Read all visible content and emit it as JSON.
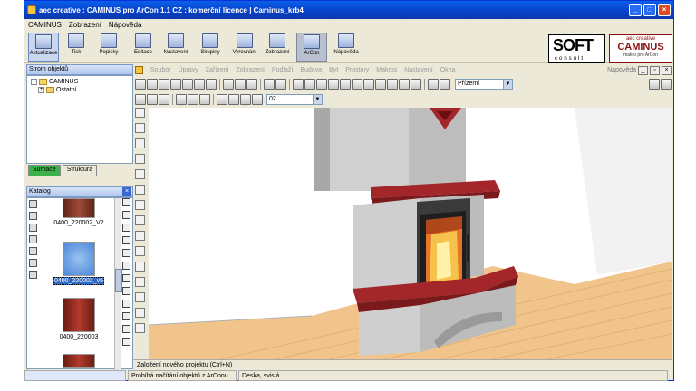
{
  "window": {
    "title": "aec creative : CAMINUS pro ArCon 1.1 CZ : komerční licence | Caminus_krb4",
    "controls": [
      "_",
      "□",
      "×"
    ]
  },
  "menu": [
    "CAMINUS",
    "Zobrazení",
    "Nápověda"
  ],
  "big_toolbar": [
    {
      "label": "Aktualizace",
      "icon": "update-icon"
    },
    {
      "label": "Tisk",
      "icon": "printer-icon"
    },
    {
      "label": "Popisky",
      "icon": "labels-icon"
    },
    {
      "label": "Editace",
      "icon": "edit-icon"
    },
    {
      "label": "Nastavení",
      "icon": "settings-icon"
    },
    {
      "label": "Skupiny",
      "icon": "groups-icon"
    },
    {
      "label": "Vyrovnání",
      "icon": "align-icon"
    },
    {
      "label": "Zobrazení",
      "icon": "view-icon"
    },
    {
      "label": "ArCon",
      "icon": "arcon-icon"
    },
    {
      "label": "Nápověda",
      "icon": "help-icon"
    }
  ],
  "logos": {
    "soft_big": "SOFT",
    "soft_small": "consult",
    "caminus_top": "aec creative",
    "caminus_main": "CAMINUS",
    "caminus_sub": "makro pro ArCon"
  },
  "object_tree": {
    "title": "Strom objektů",
    "items": [
      {
        "label": "CAMINUS",
        "expand": "-"
      },
      {
        "label": "Ostatní",
        "expand": "+"
      }
    ]
  },
  "tabs": [
    {
      "label": "Sumace",
      "active": true
    },
    {
      "label": "Struktura",
      "active": false
    }
  ],
  "catalog": {
    "title": "Katalog",
    "items": [
      {
        "label": "0400_220002_V2",
        "selected": false
      },
      {
        "label": "0400_220002_v5",
        "selected": true
      },
      {
        "label": "0400_220003",
        "selected": false
      }
    ]
  },
  "arcon_menu": {
    "items": [
      "Soubor",
      "Úpravy",
      "Zařízení",
      "Zobrazení",
      "Podlaží",
      "Budova",
      "Byt",
      "Prostory",
      "Makros",
      "Nastavení",
      "Okna"
    ],
    "help": "Nápověda"
  },
  "toolbar1": {
    "level_dropdown": "Přízemí"
  },
  "toolbar2": {
    "floor_dropdown": "02"
  },
  "status": {
    "line1": "Založení nového projektu (Ctrl+N)",
    "line2": "Probíhá načítání objektů z ArConu ...",
    "line3": "Deska, svislá"
  },
  "colors": {
    "titlebar": "#0a5fe8",
    "fireplace_body": "#c9c9c9",
    "fireplace_shelf": "#a3262a",
    "floor": "#f0c48a"
  }
}
